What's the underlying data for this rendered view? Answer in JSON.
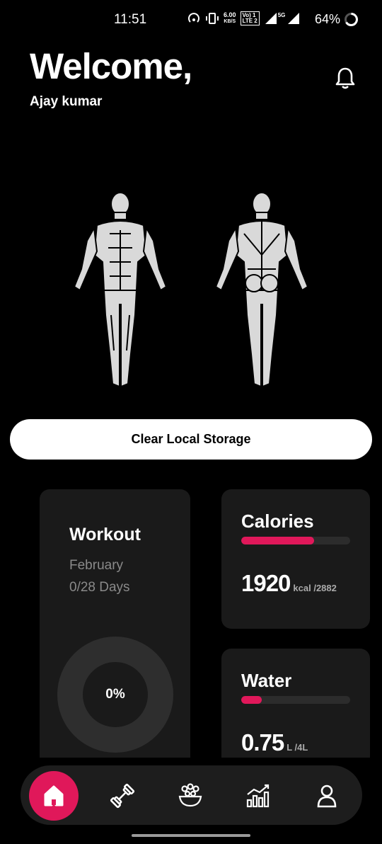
{
  "status_bar": {
    "time": "11:51",
    "net_speed_value": "6.00",
    "net_speed_unit": "KB/S",
    "volte_top": "Vo) 1",
    "volte_bottom": "LTE 2",
    "signal_label": "5G",
    "battery": "64%"
  },
  "header": {
    "greeting": "Welcome,",
    "username": "Ajay kumar"
  },
  "actions": {
    "clear_storage": "Clear Local Storage"
  },
  "workout": {
    "title": "Workout",
    "month": "February",
    "days": "0/28 Days",
    "progress_label": "0%",
    "progress": 0
  },
  "calories": {
    "title": "Calories",
    "value": "1920",
    "unit": "kcal /2882",
    "progress": 0.67
  },
  "water": {
    "title": "Water",
    "value": "0.75",
    "unit": "L /4L",
    "progress": 0.19
  },
  "colors": {
    "accent": "#e0185a",
    "card": "#1a1a1a",
    "background": "#000000"
  },
  "nav": {
    "items": [
      "home-icon",
      "dumbbell-icon",
      "food-bowl-icon",
      "stats-chart-icon",
      "profile-icon"
    ],
    "active": "home-icon"
  }
}
